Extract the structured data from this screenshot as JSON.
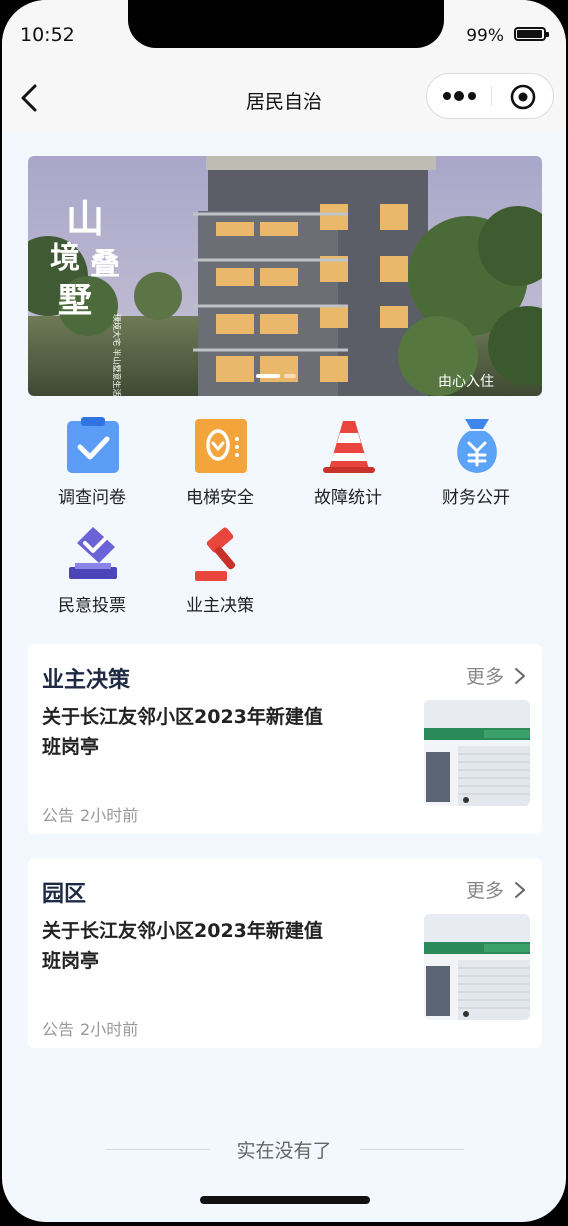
{
  "status_bar": {
    "time": "10:52",
    "battery": "99%"
  },
  "nav": {
    "title": "居民自治"
  },
  "banner": {
    "text_big": "山境叠墅",
    "text_small": "璞境大宅 半山墅意生活",
    "watermark": "由心入住",
    "slides": 2,
    "active_slide": 1
  },
  "features": [
    {
      "label": "调查问卷",
      "icon": "clipboard-check-icon"
    },
    {
      "label": "电梯安全",
      "icon": "elevator-safety-icon"
    },
    {
      "label": "故障统计",
      "icon": "traffic-cone-icon"
    },
    {
      "label": "财务公开",
      "icon": "money-bag-icon"
    },
    {
      "label": "民意投票",
      "icon": "ballot-box-icon"
    },
    {
      "label": "业主决策",
      "icon": "gavel-icon"
    }
  ],
  "cards": [
    {
      "title": "业主决策",
      "more": "更多",
      "headline": "关于长江友邻小区2023年新建值班岗亭",
      "tag": "公告",
      "time": "2小时前"
    },
    {
      "title": "园区",
      "more": "更多",
      "headline": "关于长江友邻小区2023年新建值班岗亭",
      "tag": "公告",
      "time": "2小时前"
    }
  ],
  "footer": {
    "end_text": "实在没有了"
  },
  "colors": {
    "page_bg": "#f3f7fe",
    "title_navy": "#1e2a44",
    "accent_blue": "#4a8ff0",
    "accent_red": "#e8453c",
    "accent_orange": "#f3a43a"
  }
}
